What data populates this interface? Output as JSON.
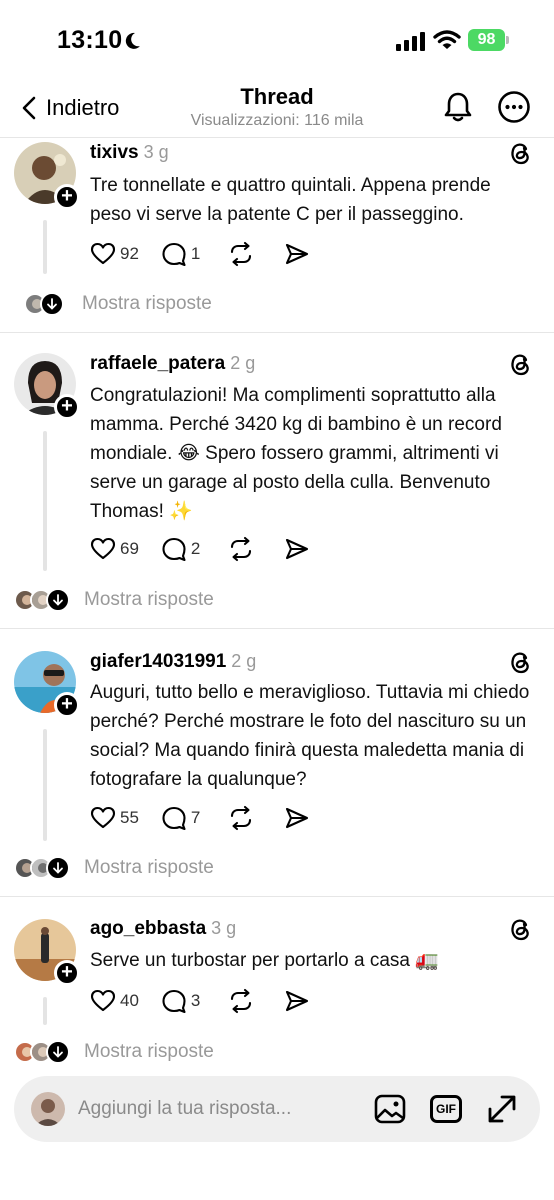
{
  "status": {
    "time": "13:10",
    "battery": "98"
  },
  "nav": {
    "back_label": "Indietro",
    "title": "Thread",
    "subtitle": "Visualizzazioni: 116 mila"
  },
  "posts": [
    {
      "username": "tixivs",
      "age": "3 g",
      "text": "Tre tonnellate e quattro quintali. Appena prende peso vi serve la patente C per il passeggino.",
      "likes": "92",
      "comments": "1",
      "replies_label": "Mostra risposte"
    },
    {
      "username": "raffaele_patera",
      "age": "2 g",
      "text": "Congratulazioni! Ma complimenti soprattutto alla mamma. Perché 3420 kg di bambino è un record mondiale. 😂 Spero fossero grammi, altrimenti vi serve un garage al posto della culla. Benvenuto Thomas! ✨",
      "likes": "69",
      "comments": "2",
      "replies_label": "Mostra risposte"
    },
    {
      "username": "giafer14031991",
      "age": "2 g",
      "text": "Auguri, tutto bello e meraviglioso. Tuttavia mi chiedo perché? Perché mostrare le foto del nascituro su un social? Ma quando finirà questa maledetta mania di fotografare la qualunque?",
      "likes": "55",
      "comments": "7",
      "replies_label": "Mostra risposte"
    },
    {
      "username": "ago_ebbasta",
      "age": "3 g",
      "text": "Serve un turbostar per portarlo a casa 🚛",
      "likes": "40",
      "comments": "3",
      "replies_label": "Mostra risposte"
    }
  ],
  "composer": {
    "placeholder": "Aggiungi la tua risposta...",
    "gif_label": "GIF"
  },
  "colors": {
    "battery": "#4cd964",
    "muted": "#999999"
  }
}
